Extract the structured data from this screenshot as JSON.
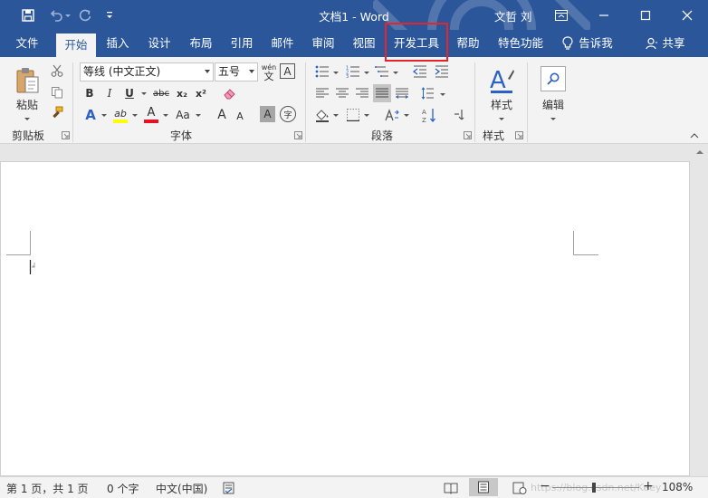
{
  "titlebar": {
    "title": "文档1  -  Word",
    "user": "文哲 刘",
    "icons": [
      "save-icon",
      "undo-icon",
      "redo-icon",
      "customize-qat-icon",
      "ribbon-display-icon",
      "minimize-icon",
      "maximize-icon",
      "close-icon"
    ]
  },
  "tabs": {
    "file": "文件",
    "home": "开始",
    "insert": "插入",
    "design": "设计",
    "layout": "布局",
    "references": "引用",
    "mailings": "邮件",
    "review": "审阅",
    "view": "视图",
    "developer": "开发工具",
    "help": "帮助",
    "special": "特色功能",
    "tell_me": "告诉我",
    "share": "共享"
  },
  "ribbon": {
    "clipboard": {
      "paste": "粘贴",
      "label": "剪贴板"
    },
    "font": {
      "font_name": "等线 (中文正文)",
      "font_size": "五号",
      "wen_glyph": "wén",
      "wen_char": "文",
      "border_char": "A",
      "bold": "B",
      "italic": "I",
      "underline": "U",
      "strike": "abc",
      "subscript": "x₂",
      "superscript": "x²",
      "text_effect": "A",
      "highlight": "ab",
      "font_color": "A",
      "change_case": "Aa",
      "grow": "A",
      "shrink": "A",
      "shading_char": "A",
      "enclose_char": "字",
      "label": "字体"
    },
    "paragraph": {
      "label": "段落"
    },
    "styles": {
      "styles_btn": "样式",
      "label": "样式"
    },
    "editing": {
      "edit_btn": "编辑"
    }
  },
  "status": {
    "page": "第 1 页，共 1 页",
    "words": "0 个字",
    "language": "中文(中国)",
    "zoom": "108%",
    "watermark": "https://blog.csdn.net/Keey"
  },
  "colors": {
    "brand": "#2b579a",
    "highlight_box": "#e8232a",
    "highlight_yellow": "#ffff00",
    "font_red": "#e81123"
  }
}
